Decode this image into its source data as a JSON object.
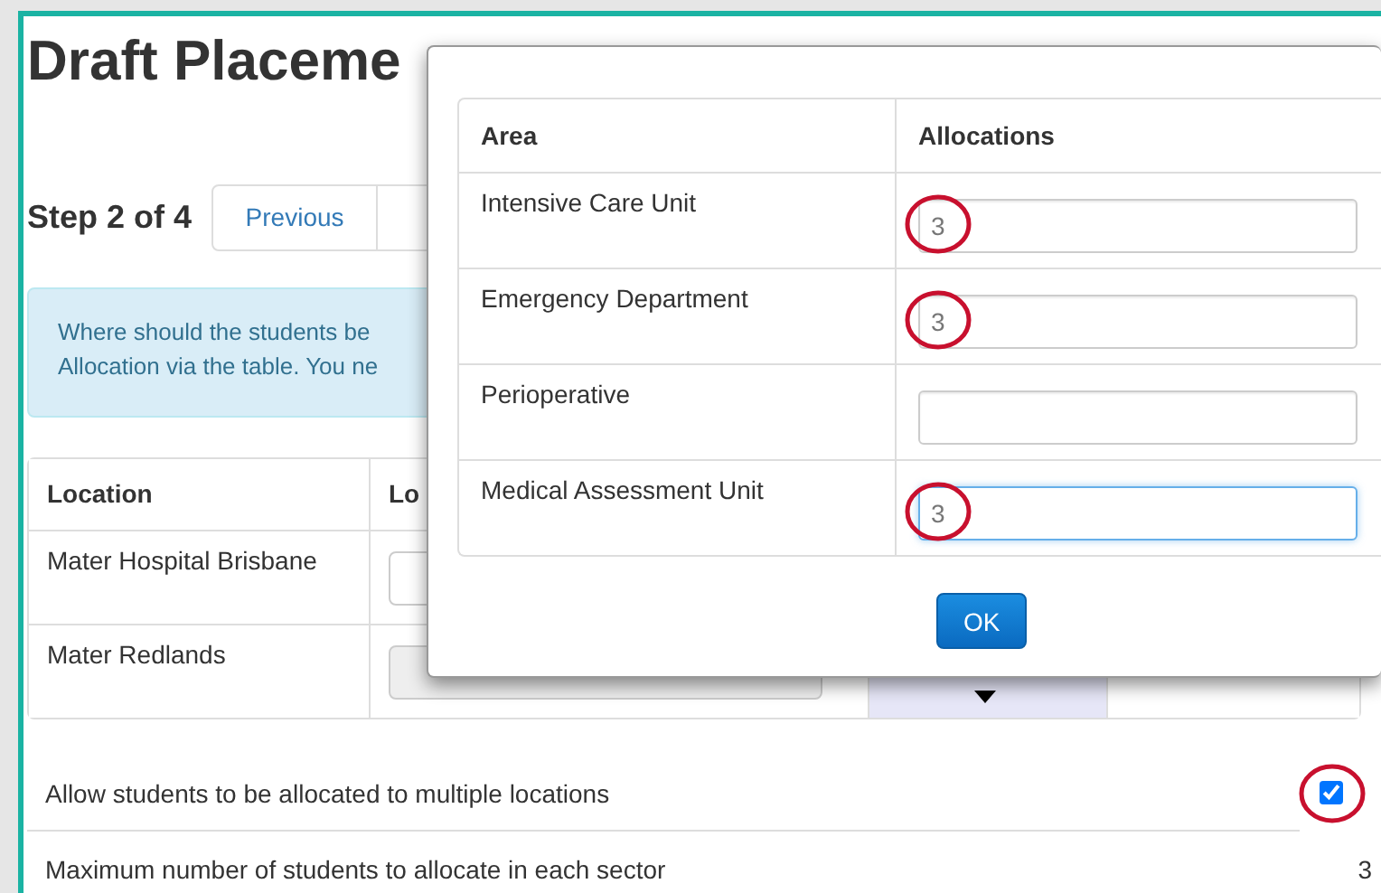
{
  "page": {
    "title": "Draft Placeme"
  },
  "stepper": {
    "label": "Step 2 of 4",
    "buttons": [
      "Previous"
    ]
  },
  "info": {
    "lines": [
      "Where should the students be",
      "Allocation via the table. You ne"
    ]
  },
  "locations": {
    "columns": [
      "Location",
      "Lo"
    ],
    "rows": [
      {
        "name": "Mater Hospital Brisbane",
        "disabled": false,
        "selected": false
      },
      {
        "name": "Mater Redlands",
        "disabled": true,
        "selected": true
      }
    ]
  },
  "options": [
    {
      "kind": "checkbox",
      "label": "Allow students to be allocated to multiple locations",
      "checked": true,
      "circled": true
    },
    {
      "kind": "value",
      "label": "Maximum number of students to allocate in each sector",
      "value": "3",
      "circled": false
    }
  ],
  "dialog": {
    "columns": [
      "Area",
      "Allocations"
    ],
    "rows": [
      {
        "area": "Intensive Care Unit",
        "value": "3",
        "circled": true,
        "focused": false
      },
      {
        "area": "Emergency Department",
        "value": "3",
        "circled": true,
        "focused": false
      },
      {
        "area": "Perioperative",
        "circled": false,
        "focused": false
      },
      {
        "area": "Medical Assessment Unit",
        "value": "3",
        "circled": true,
        "focused": true
      }
    ],
    "button": "OK"
  }
}
